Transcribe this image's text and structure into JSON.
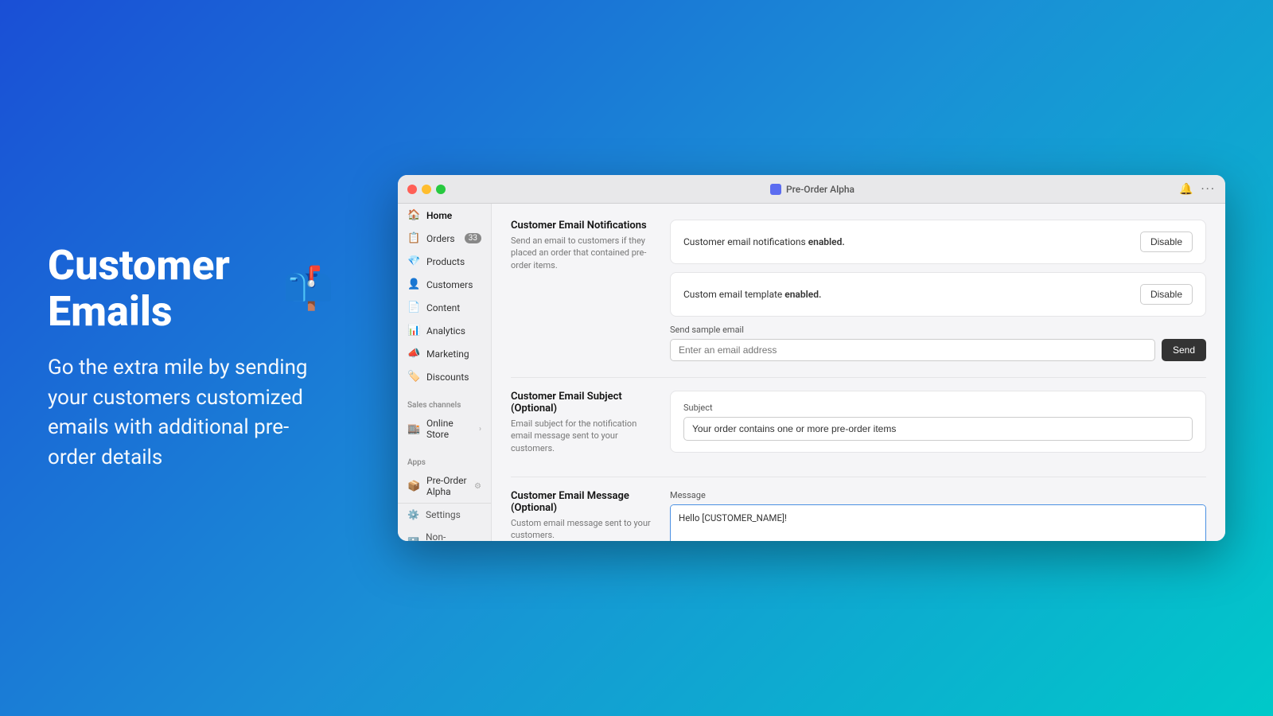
{
  "hero": {
    "title": "Customer Emails",
    "emoji": "📫",
    "description": "Go the extra mile by sending your customers customized emails with additional pre-order details"
  },
  "window": {
    "title": "Pre-Order Alpha",
    "controls": {
      "red": "close",
      "yellow": "minimize",
      "green": "maximize"
    },
    "bell_icon": "🔔",
    "dots_icon": "···"
  },
  "sidebar": {
    "items": [
      {
        "id": "home",
        "icon": "🏠",
        "label": "Home",
        "active": true
      },
      {
        "id": "orders",
        "icon": "📋",
        "label": "Orders",
        "badge": "33"
      },
      {
        "id": "products",
        "icon": "💎",
        "label": "Products"
      },
      {
        "id": "customers",
        "icon": "👤",
        "label": "Customers"
      },
      {
        "id": "content",
        "icon": "📄",
        "label": "Content"
      },
      {
        "id": "analytics",
        "icon": "📊",
        "label": "Analytics"
      },
      {
        "id": "marketing",
        "icon": "📣",
        "label": "Marketing"
      },
      {
        "id": "discounts",
        "icon": "🏷️",
        "label": "Discounts"
      }
    ],
    "sales_channels_section": "Sales channels",
    "sales_channels": [
      {
        "id": "online-store",
        "icon": "🏬",
        "label": "Online Store"
      }
    ],
    "apps_section": "Apps",
    "apps": [
      {
        "id": "pre-order-alpha",
        "icon": "📦",
        "label": "Pre-Order Alpha"
      }
    ],
    "footer": [
      {
        "id": "settings",
        "icon": "⚙️",
        "label": "Settings"
      },
      {
        "id": "non-transferable",
        "icon": "ℹ️",
        "label": "Non-transferable"
      }
    ]
  },
  "main": {
    "sections": [
      {
        "id": "customer-email-notifications",
        "title": "Customer Email Notifications",
        "description": "Send an email to customers if they placed an order that contained pre-order items.",
        "notifications_status_text": "Customer email notifications ",
        "notifications_status_bold": "enabled.",
        "disable_notifications_label": "Disable",
        "template_status_text": "Custom email template ",
        "template_status_bold": "enabled.",
        "disable_template_label": "Disable",
        "send_sample_label": "Send sample email",
        "send_input_placeholder": "Enter an email address",
        "send_button_label": "Send"
      },
      {
        "id": "customer-email-subject",
        "title": "Customer Email Subject (Optional)",
        "description": "Email subject for the notification email message sent to your customers.",
        "subject_label": "Subject",
        "subject_value": "Your order contains one or more pre-order items"
      },
      {
        "id": "customer-email-message",
        "title": "Customer Email Message (Optional)",
        "description": "Custom email message sent to your customers.",
        "message_label": "Message",
        "message_value": "Hello [CUSTOMER_NAME]!\n\nYou have one or more Pre-Order items as part of your order. Details below:\n\n[LINE_ITEMS]\n\nWe'll ship these items separately as soon as they arrive in stock, however please contact us if you have any questions.\n\nSincerely,"
      }
    ]
  }
}
